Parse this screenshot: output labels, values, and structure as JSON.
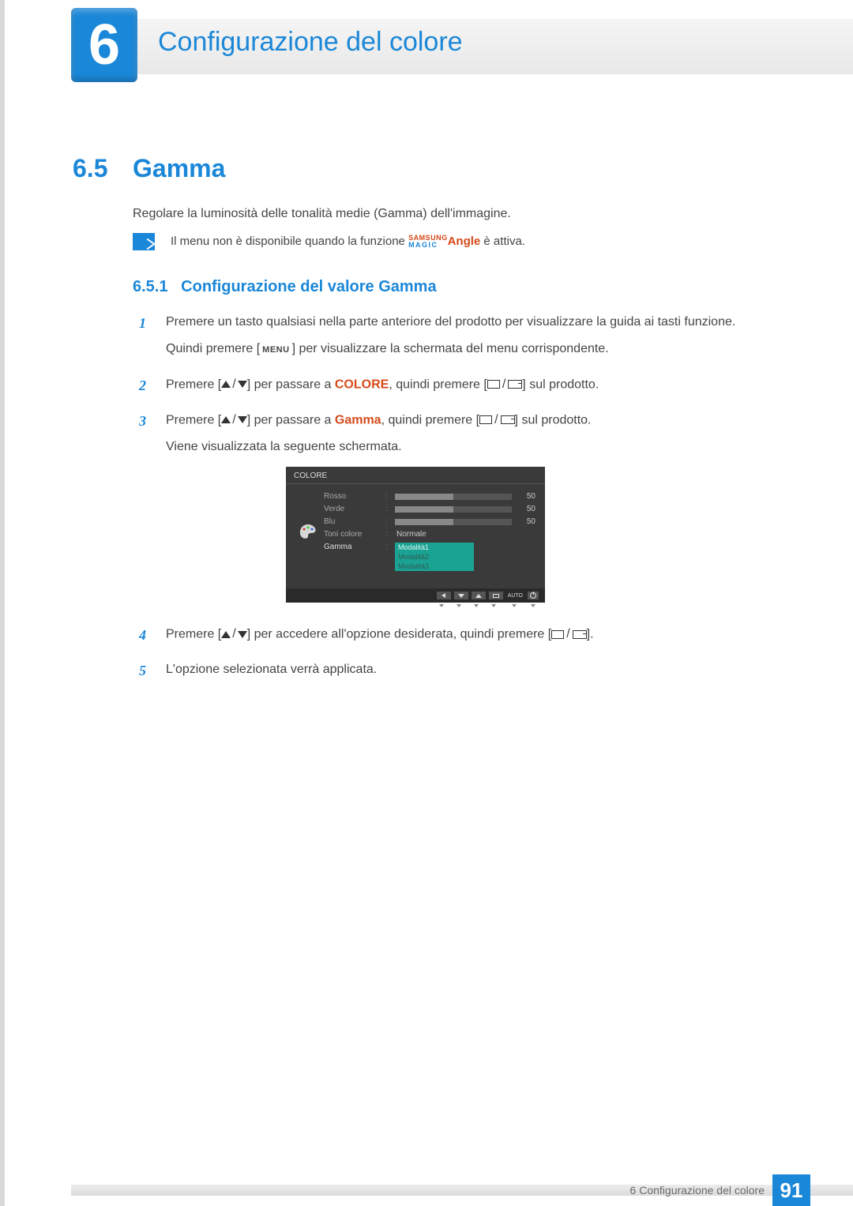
{
  "chapter": {
    "number": "6",
    "title": "Configurazione del colore"
  },
  "section": {
    "number": "6.5",
    "title": "Gamma"
  },
  "intro": "Regolare la luminosità delle tonalità medie (Gamma) dell'immagine.",
  "note": {
    "before": "Il menu non è disponibile quando la funzione ",
    "magic_top": "SAMSUNG",
    "magic_bot": "MAGIC",
    "angle": "Angle",
    "after": " è attiva."
  },
  "subsection": {
    "number": "6.5.1",
    "title": "Configurazione del valore Gamma"
  },
  "steps": {
    "s1": {
      "num": "1",
      "p1": "Premere un tasto qualsiasi nella parte anteriore del prodotto per visualizzare la guida ai tasti funzione.",
      "p2a": "Quindi premere [",
      "menu": "MENU",
      "p2b": "] per visualizzare la schermata del menu corrispondente."
    },
    "s2": {
      "num": "2",
      "a": "Premere [",
      "b": "] per passare a ",
      "colore": "COLORE",
      "c": ", quindi premere [",
      "d": "] sul prodotto."
    },
    "s3": {
      "num": "3",
      "a": "Premere [",
      "b": "] per passare a ",
      "gamma": "Gamma",
      "c": ", quindi premere [",
      "d": "] sul prodotto.",
      "p2": "Viene visualizzata la seguente schermata."
    },
    "s4": {
      "num": "4",
      "a": "Premere [",
      "b": "] per accedere all'opzione desiderata, quindi premere [",
      "c": "]."
    },
    "s5": {
      "num": "5",
      "text": "L'opzione selezionata verrà applicata."
    }
  },
  "osd": {
    "title": "COLORE",
    "rows": {
      "rosso": {
        "label": "Rosso",
        "value": "50",
        "fill": 50
      },
      "verde": {
        "label": "Verde",
        "value": "50",
        "fill": 50
      },
      "blu": {
        "label": "Blu",
        "value": "50",
        "fill": 50
      },
      "toni": {
        "label": "Toni colore",
        "value": "Normale"
      },
      "gamma": {
        "label": "Gamma",
        "options": [
          "Modalità1",
          "Modalità2",
          "Modalità3"
        ],
        "selected": 0
      }
    },
    "nav_auto": "AUTO"
  },
  "footer": {
    "text": "6 Configurazione del colore",
    "page": "91"
  }
}
